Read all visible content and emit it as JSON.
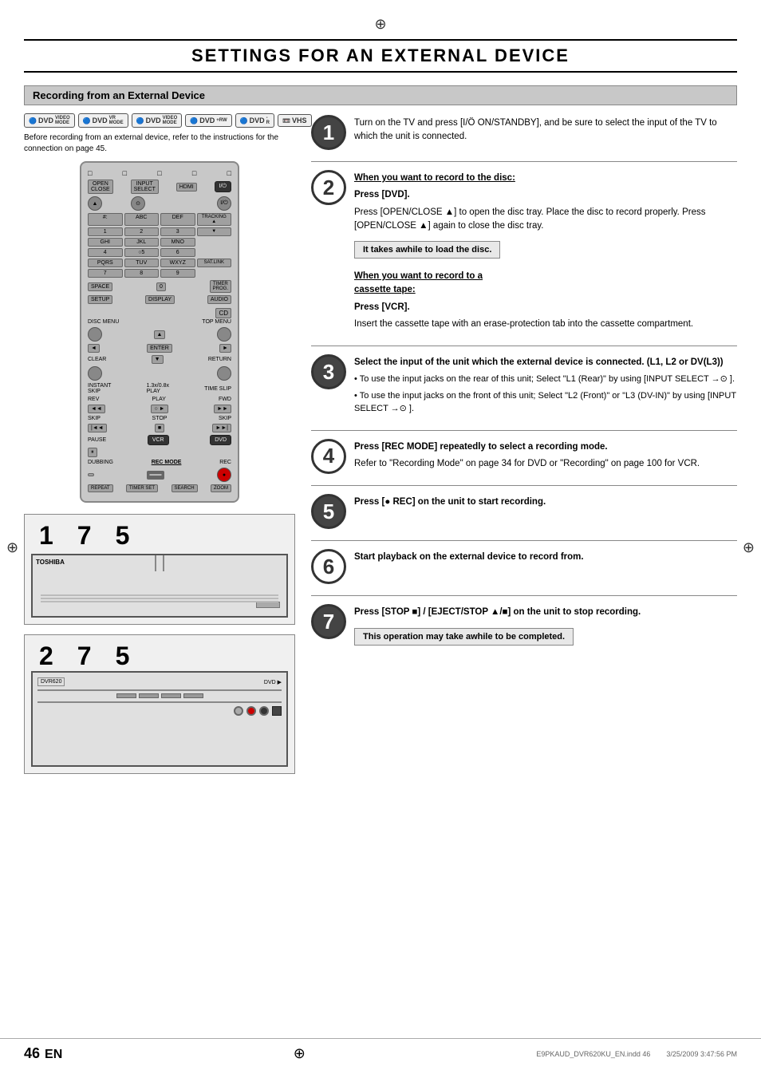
{
  "page": {
    "top_marker": "⊕",
    "title": "SETTINGS FOR AN EXTERNAL DEVICE",
    "section_header": "Recording from an External Device",
    "before_text": "Before recording from an external device, refer to the instructions for the connection on page 45.",
    "device_icons": [
      {
        "label": "DVD",
        "sub": "VIDEO MODE"
      },
      {
        "label": "DVD",
        "sub": "VR MODE"
      },
      {
        "label": "DVD",
        "sub": "VIDEO MODE"
      },
      {
        "label": "DVD",
        "sub": "+RW"
      },
      {
        "label": "DVD",
        "sub": "-R"
      },
      {
        "label": "VHS"
      }
    ],
    "tv_numbers": "1  7  5",
    "vcr_numbers": "2  7  5",
    "steps": [
      {
        "num": "1",
        "content": "Turn on the TV and press [I/Ö ON/STANDBY], and be sure to select the input of the TV to which the unit is connected."
      },
      {
        "num": "2",
        "sub_heading_disc": "When you want to record to the disc:",
        "press_dvd": "Press [DVD].",
        "disc_detail": "Press [OPEN/CLOSE ▲] to open the disc tray. Place the disc to record properly. Press [OPEN/CLOSE ▲] again to close the disc tray.",
        "info_box": "It takes awhile to load\nthe disc.",
        "sub_heading_cassette": "When you want to record to a cassette tape:",
        "press_vcr": "Press [VCR].",
        "cassette_detail": "Insert the cassette tape with an erase-protection tab into the cassette compartment."
      },
      {
        "num": "3",
        "content": "Select the input of the unit which the external device is connected. (L1, L2 or DV(L3))",
        "bullets": [
          "To use the input jacks on the rear of this unit; Select \"L1 (Rear)\" by using [INPUT SELECT →⊙ ].",
          "To use the input jacks on the front of this unit; Select \"L2 (Front)\" or \"L3 (DV-IN)\" by using [INPUT SELECT →⊙ ]."
        ]
      },
      {
        "num": "4",
        "content": "Press [REC MODE] repeatedly to select a recording mode.",
        "detail": "Refer to \"Recording Mode\" on page 34 for DVD or \"Recording\" on page 100 for VCR."
      },
      {
        "num": "5",
        "content": "Press [● REC] on the unit to start recording."
      },
      {
        "num": "6",
        "content": "Start playback on the external device to record from."
      },
      {
        "num": "7",
        "content": "Press [STOP ■] / [EJECT/STOP ▲/■] on the unit to stop recording.",
        "info_box": "This operation may take\nawhile to be completed."
      }
    ],
    "footer": {
      "page_number": "46",
      "lang": "EN",
      "file": "E9PKAUD_DVR620KU_EN.indd  46",
      "date": "3/25/2009  3:47:56 PM",
      "bottom_marker": "⊕"
    }
  }
}
